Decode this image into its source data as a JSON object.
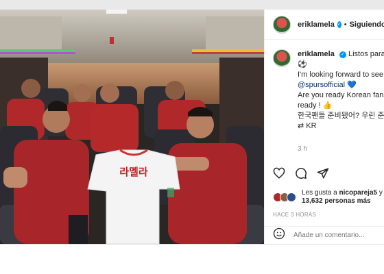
{
  "header": {
    "username": "eriklamela",
    "follow_label": "Siguiendo"
  },
  "caption": {
    "username": "eriklamela",
    "line1": "Listos para m",
    "line2_emoji": "⚽",
    "line3": "I'm looking forward to see",
    "mention": "@spursofficial",
    "heart": "💙",
    "line5": "Are you ready Korean fans?",
    "line6": "ready ! 👍",
    "line7": "한국팬들 준비됐어? 우린 준",
    "line8": "⇄ KR"
  },
  "time": "3 h",
  "likes": {
    "prefix": "Les gusta a",
    "user": "nicopareja5",
    "conj": "y",
    "count": "13,632 personas más"
  },
  "ago": "HACE 3 HORAS",
  "comment": {
    "placeholder": "Añade un comentario..."
  },
  "photo": {
    "jersey_text": "라멜라"
  },
  "icons": [
    "heart-icon",
    "comment-icon",
    "share-icon",
    "emoji-icon",
    "verified-icon"
  ]
}
